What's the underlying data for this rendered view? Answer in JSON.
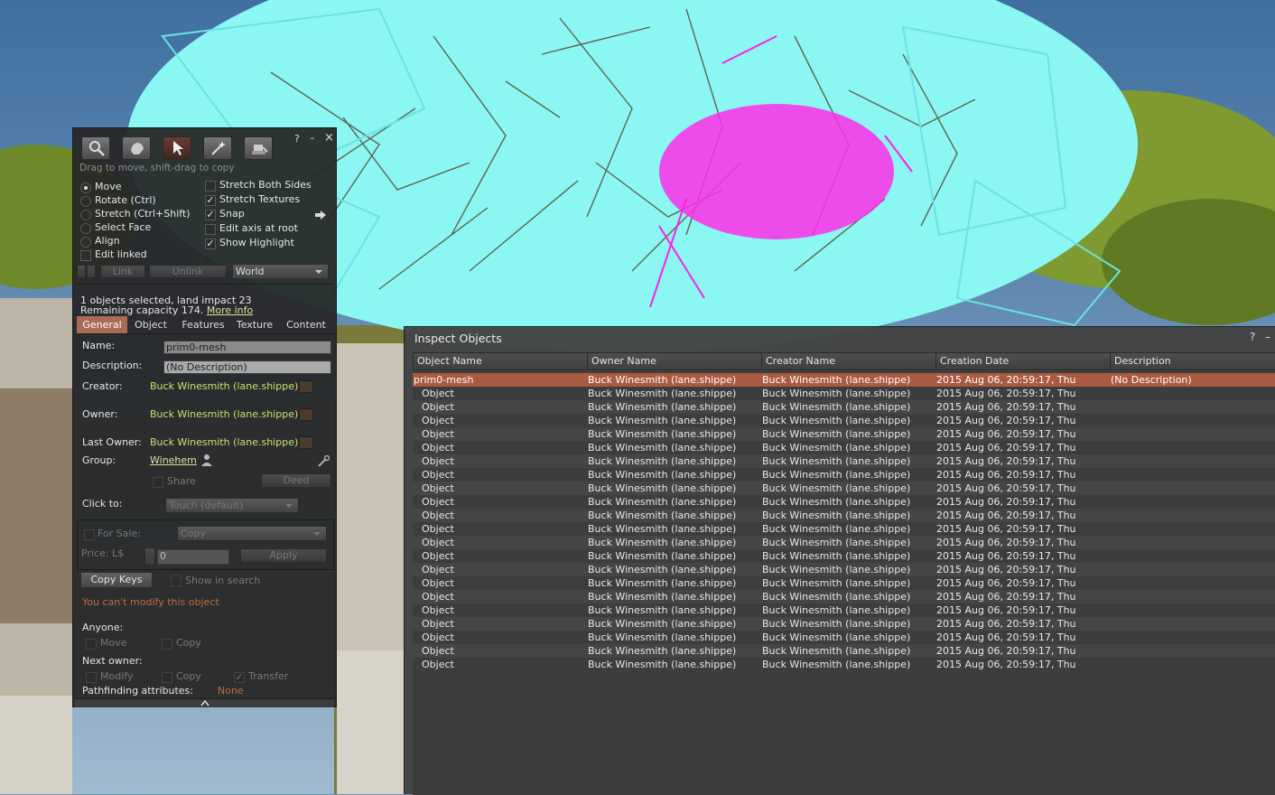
{
  "build_tool": {
    "help": "?",
    "minimize": "–",
    "close": "×",
    "hint": "Drag to move, shift-drag to copy",
    "modes": [
      "Move",
      "Rotate (Ctrl)",
      "Stretch (Ctrl+Shift)",
      "Select Face",
      "Align"
    ],
    "selected_mode": "Move",
    "edit_linked": "Edit linked",
    "options": [
      {
        "label": "Stretch Both Sides",
        "checked": false
      },
      {
        "label": "Stretch Textures",
        "checked": true
      },
      {
        "label": "Snap",
        "checked": true
      },
      {
        "label": "Edit axis at root",
        "checked": false
      },
      {
        "label": "Show Highlight",
        "checked": true
      }
    ],
    "link_label": "Link",
    "unlink_label": "Unlink",
    "ruler_mode": "World",
    "selection_info": "1 objects selected, land impact 23",
    "remaining": "Remaining capacity 174.",
    "more_info": "More info",
    "tabs": [
      "General",
      "Object",
      "Features",
      "Texture",
      "Content"
    ],
    "active_tab": "General",
    "general": {
      "name_label": "Name:",
      "name_value": "prim0-mesh",
      "description_label": "Description:",
      "description_value": "(No Description)",
      "creator_label": "Creator:",
      "creator_value": "Buck Winesmith (lane.shippe)",
      "owner_label": "Owner:",
      "owner_value": "Buck Winesmith (lane.shippe)",
      "last_owner_label": "Last Owner:",
      "last_owner_value": "Buck Winesmith (lane.shippe)",
      "group_label": "Group:",
      "group_value": "Winehem",
      "share_label": "Share",
      "deed_label": "Deed",
      "click_to_label": "Click to:",
      "click_to_value": "Touch  (default)",
      "for_sale_label": "For Sale:",
      "sale_type": "Copy",
      "price_label": "Price: L$",
      "price_value": "0",
      "apply_label": "Apply",
      "copy_keys_label": "Copy Keys",
      "show_in_search_label": "Show in search",
      "warning": "You can't modify this object",
      "anyone_label": "Anyone:",
      "anyone_move": "Move",
      "anyone_copy": "Copy",
      "next_owner_label": "Next owner:",
      "next_modify": "Modify",
      "next_copy": "Copy",
      "next_transfer": "Transfer",
      "pathfinding_label": "Pathfinding attributes:",
      "pathfinding_value": "None"
    }
  },
  "inspect": {
    "title": "Inspect Objects",
    "help": "?",
    "minimize": "–",
    "columns": [
      "Object Name",
      "Owner Name",
      "Creator Name",
      "Creation Date",
      "Description"
    ],
    "rows": [
      {
        "name": "prim0-mesh",
        "owner": "Buck Winesmith (lane.shippe)",
        "creator": "Buck Winesmith (lane.shippe)",
        "date": "2015 Aug 06, 20:59:17, Thu",
        "desc": "(No Description)"
      },
      {
        "name": "Object",
        "owner": "Buck Winesmith (lane.shippe)",
        "creator": "Buck Winesmith (lane.shippe)",
        "date": "2015 Aug 06, 20:59:17, Thu",
        "desc": ""
      },
      {
        "name": "Object",
        "owner": "Buck Winesmith (lane.shippe)",
        "creator": "Buck Winesmith (lane.shippe)",
        "date": "2015 Aug 06, 20:59:17, Thu",
        "desc": ""
      },
      {
        "name": "Object",
        "owner": "Buck Winesmith (lane.shippe)",
        "creator": "Buck Winesmith (lane.shippe)",
        "date": "2015 Aug 06, 20:59:17, Thu",
        "desc": ""
      },
      {
        "name": "Object",
        "owner": "Buck Winesmith (lane.shippe)",
        "creator": "Buck Winesmith (lane.shippe)",
        "date": "2015 Aug 06, 20:59:17, Thu",
        "desc": ""
      },
      {
        "name": "Object",
        "owner": "Buck Winesmith (lane.shippe)",
        "creator": "Buck Winesmith (lane.shippe)",
        "date": "2015 Aug 06, 20:59:17, Thu",
        "desc": ""
      },
      {
        "name": "Object",
        "owner": "Buck Winesmith (lane.shippe)",
        "creator": "Buck Winesmith (lane.shippe)",
        "date": "2015 Aug 06, 20:59:17, Thu",
        "desc": ""
      },
      {
        "name": "Object",
        "owner": "Buck Winesmith (lane.shippe)",
        "creator": "Buck Winesmith (lane.shippe)",
        "date": "2015 Aug 06, 20:59:17, Thu",
        "desc": ""
      },
      {
        "name": "Object",
        "owner": "Buck Winesmith (lane.shippe)",
        "creator": "Buck Winesmith (lane.shippe)",
        "date": "2015 Aug 06, 20:59:17, Thu",
        "desc": ""
      },
      {
        "name": "Object",
        "owner": "Buck Winesmith (lane.shippe)",
        "creator": "Buck Winesmith (lane.shippe)",
        "date": "2015 Aug 06, 20:59:17, Thu",
        "desc": ""
      },
      {
        "name": "Object",
        "owner": "Buck Winesmith (lane.shippe)",
        "creator": "Buck Winesmith (lane.shippe)",
        "date": "2015 Aug 06, 20:59:17, Thu",
        "desc": ""
      },
      {
        "name": "Object",
        "owner": "Buck Winesmith (lane.shippe)",
        "creator": "Buck Winesmith (lane.shippe)",
        "date": "2015 Aug 06, 20:59:17, Thu",
        "desc": ""
      },
      {
        "name": "Object",
        "owner": "Buck Winesmith (lane.shippe)",
        "creator": "Buck Winesmith (lane.shippe)",
        "date": "2015 Aug 06, 20:59:17, Thu",
        "desc": ""
      },
      {
        "name": "Object",
        "owner": "Buck Winesmith (lane.shippe)",
        "creator": "Buck Winesmith (lane.shippe)",
        "date": "2015 Aug 06, 20:59:17, Thu",
        "desc": ""
      },
      {
        "name": "Object",
        "owner": "Buck Winesmith (lane.shippe)",
        "creator": "Buck Winesmith (lane.shippe)",
        "date": "2015 Aug 06, 20:59:17, Thu",
        "desc": ""
      },
      {
        "name": "Object",
        "owner": "Buck Winesmith (lane.shippe)",
        "creator": "Buck Winesmith (lane.shippe)",
        "date": "2015 Aug 06, 20:59:17, Thu",
        "desc": ""
      },
      {
        "name": "Object",
        "owner": "Buck Winesmith (lane.shippe)",
        "creator": "Buck Winesmith (lane.shippe)",
        "date": "2015 Aug 06, 20:59:17, Thu",
        "desc": ""
      },
      {
        "name": "Object",
        "owner": "Buck Winesmith (lane.shippe)",
        "creator": "Buck Winesmith (lane.shippe)",
        "date": "2015 Aug 06, 20:59:17, Thu",
        "desc": ""
      },
      {
        "name": "Object",
        "owner": "Buck Winesmith (lane.shippe)",
        "creator": "Buck Winesmith (lane.shippe)",
        "date": "2015 Aug 06, 20:59:17, Thu",
        "desc": ""
      },
      {
        "name": "Object",
        "owner": "Buck Winesmith (lane.shippe)",
        "creator": "Buck Winesmith (lane.shippe)",
        "date": "2015 Aug 06, 20:59:17, Thu",
        "desc": ""
      },
      {
        "name": "Object",
        "owner": "Buck Winesmith (lane.shippe)",
        "creator": "Buck Winesmith (lane.shippe)",
        "date": "2015 Aug 06, 20:59:17, Thu",
        "desc": ""
      },
      {
        "name": "Object",
        "owner": "Buck Winesmith (lane.shippe)",
        "creator": "Buck Winesmith (lane.shippe)",
        "date": "2015 Aug 06, 20:59:17, Thu",
        "desc": ""
      }
    ]
  },
  "colors": {
    "selection_accent": "#ab5a42",
    "highlight_cyan": "#7ff5f0",
    "highlight_magenta": "#ff1fe6",
    "link_text": "#cce06a"
  }
}
